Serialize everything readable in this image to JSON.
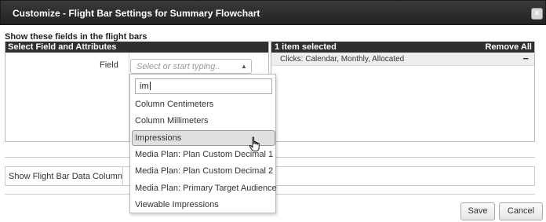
{
  "dialog": {
    "title": "Customize - Flight Bar Settings for Summary Flowchart",
    "close_glyph": "×",
    "section_title": "Show these fields in the flight bars"
  },
  "left_panel": {
    "header": "Select Field and Attributes",
    "field_label": "Field",
    "select_placeholder": "Select or start typing..",
    "search_value": "im",
    "options": [
      "Column Centimeters",
      "Column Millimeters",
      "Impressions",
      "Media Plan: Plan Custom Decimal 1",
      "Media Plan: Plan Custom Decimal 2",
      "Media Plan: Primary Target Audience",
      "Viewable Impressions"
    ],
    "highlighted_option": "Impressions"
  },
  "right_panel": {
    "header": "1 item selected",
    "remove_all": "Remove All",
    "selected_items": [
      {
        "label": "Clicks: Calendar, Monthly, Allocated",
        "remove_glyph": "−"
      }
    ]
  },
  "flight_bar": {
    "label": "Show Flight Bar Data Column",
    "value": ""
  },
  "buttons": {
    "save": "Save",
    "cancel": "Cancel"
  },
  "icons": {
    "close": "close-icon",
    "caret": "caret-up-icon",
    "cursor": "hand-pointer-icon",
    "remove": "minus-icon"
  }
}
